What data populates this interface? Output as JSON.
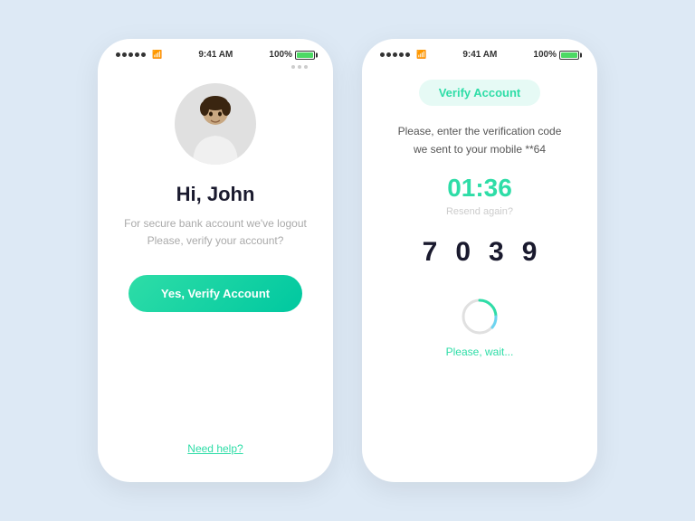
{
  "app": {
    "background": "#dde9f5"
  },
  "screen1": {
    "status_bar": {
      "time": "9:41 AM",
      "battery": "100%"
    },
    "greeting_name": "Hi, John",
    "greeting_sub": "For secure bank account we've logout\nPlease, verify your account?",
    "verify_button_label": "Yes, Verify Account",
    "help_link_label": "Need help?",
    "more_dots_label": "···"
  },
  "screen2": {
    "status_bar": {
      "time": "9:41 AM",
      "battery": "100%"
    },
    "header_label": "Verify Account",
    "description": "Please, enter the verification code\nwe sent to your mobile **64",
    "timer": "01:36",
    "resend_label": "Resend again?",
    "code_digits": [
      "7",
      "0",
      "3",
      "9"
    ],
    "please_wait_label": "Please, wait..."
  }
}
